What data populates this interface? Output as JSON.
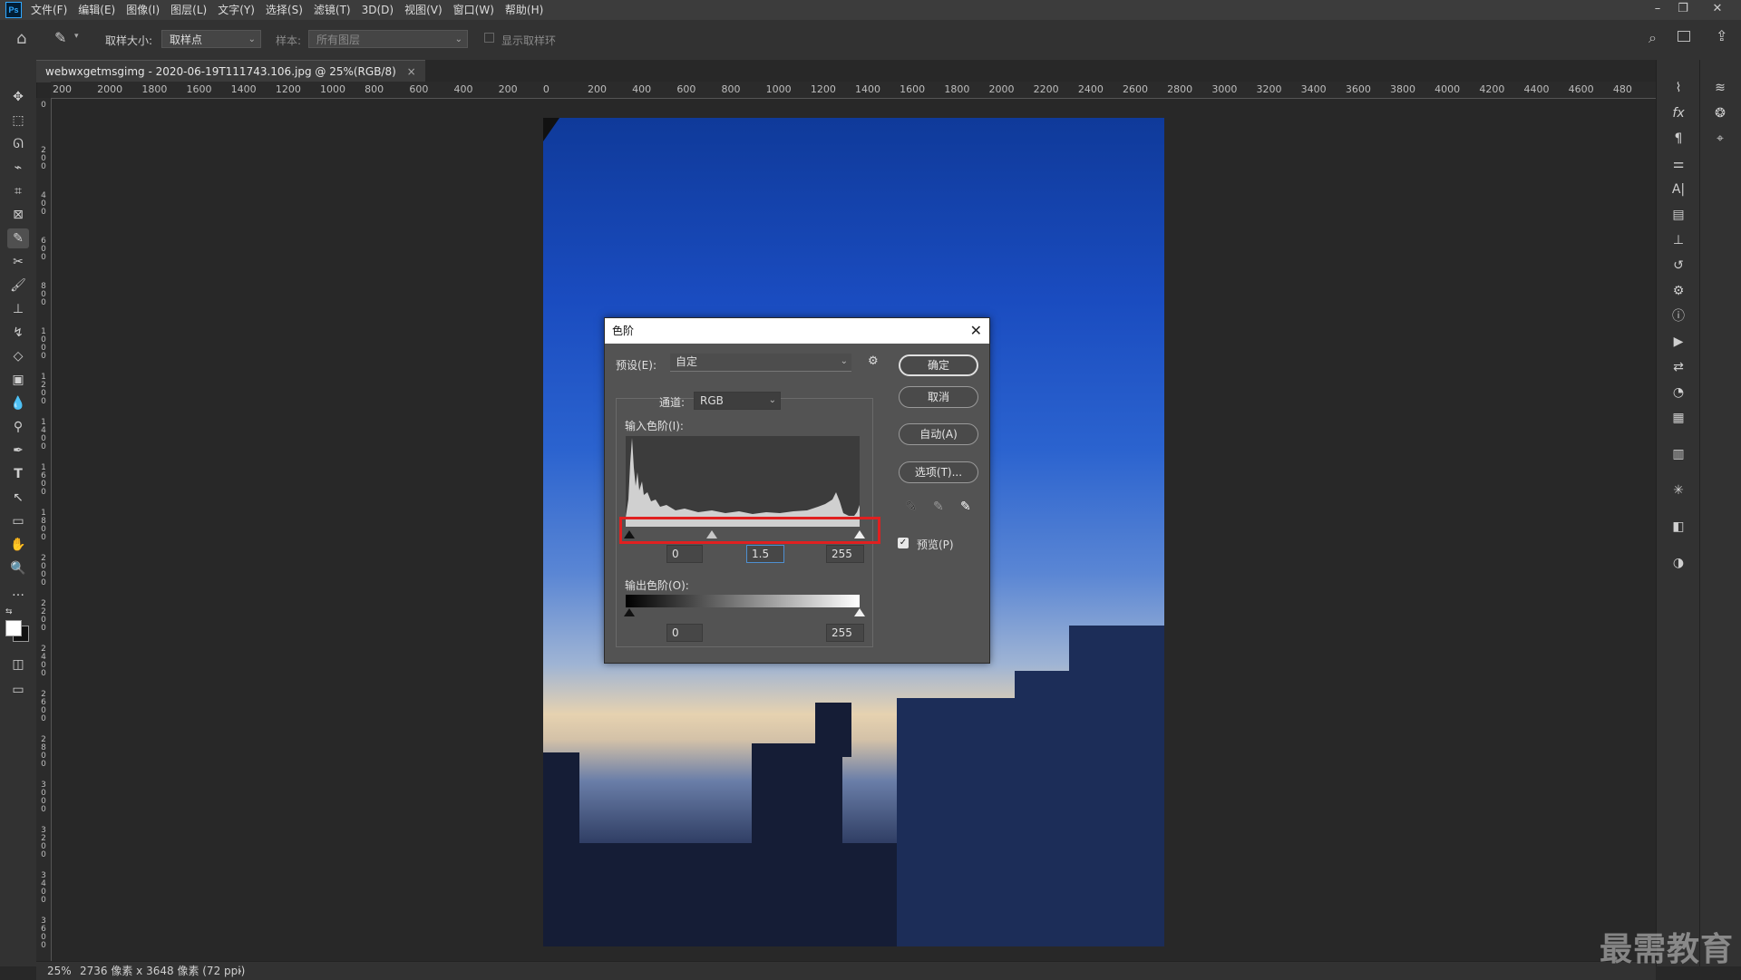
{
  "app": {
    "logo_text": "Ps",
    "menu": [
      "文件(F)",
      "编辑(E)",
      "图像(I)",
      "图层(L)",
      "文字(Y)",
      "选择(S)",
      "滤镜(T)",
      "3D(D)",
      "视图(V)",
      "窗口(W)",
      "帮助(H)"
    ],
    "window_controls": [
      "–",
      "❐",
      "✕"
    ]
  },
  "options_bar": {
    "sample_size_label": "取样大小:",
    "sample_size_value": "取样点",
    "sample_label": "样本:",
    "sample_value": "所有图层",
    "show_ring_label": "显示取样环"
  },
  "document_tab": {
    "title": "webwxgetmsgimg - 2020-06-19T111743.106.jpg @ 25%(RGB/8)",
    "close": "×"
  },
  "ruler_top_labels": [
    "200",
    "2000",
    "1800",
    "1600",
    "1400",
    "1200",
    "1000",
    "800",
    "600",
    "400",
    "200",
    "0",
    "200",
    "400",
    "600",
    "800",
    "1000",
    "1200",
    "1400",
    "1600",
    "1800",
    "2000",
    "2200",
    "2400",
    "2600",
    "2800",
    "3000",
    "3200",
    "3400",
    "3600",
    "3800",
    "4000",
    "4200",
    "4400",
    "4600",
    "480"
  ],
  "ruler_left_labels": [
    "0",
    "2 0 0",
    "4 0 0",
    "6 0 0",
    "8 0 0",
    "1 0 0 0",
    "1 2 0 0",
    "1 4 0 0",
    "1 6 0 0",
    "1 8 0 0",
    "2 0 0 0",
    "2 2 0 0",
    "2 4 0 0",
    "2 6 0 0",
    "2 8 0 0",
    "3 0 0 0",
    "3 2 0 0",
    "3 4 0 0",
    "3 6 0 0"
  ],
  "status": {
    "zoom": "25%",
    "info": "2736 像素 x 3648 像素 (72 ppi)",
    "arrow": "›"
  },
  "levels_dialog": {
    "title": "色阶",
    "close": "✕",
    "preset_label": "预设(E):",
    "preset_value": "自定",
    "channel_label": "通道:",
    "channel_value": "RGB",
    "input_label": "输入色阶(I):",
    "input_black": "0",
    "input_gamma": "1.5",
    "input_white": "255",
    "input_gamma_position": 0.36,
    "output_label": "输出色阶(O):",
    "output_black": "0",
    "output_white": "255",
    "buttons": {
      "ok": "确定",
      "cancel": "取消",
      "auto": "自动(A)",
      "options": "选项(T)..."
    },
    "preview_label": "预览(P)",
    "preview_checked": true
  },
  "watermark": "最需教育",
  "colors": {
    "accent_highlight": "#e02020",
    "ps_blue": "#31a8ff"
  }
}
